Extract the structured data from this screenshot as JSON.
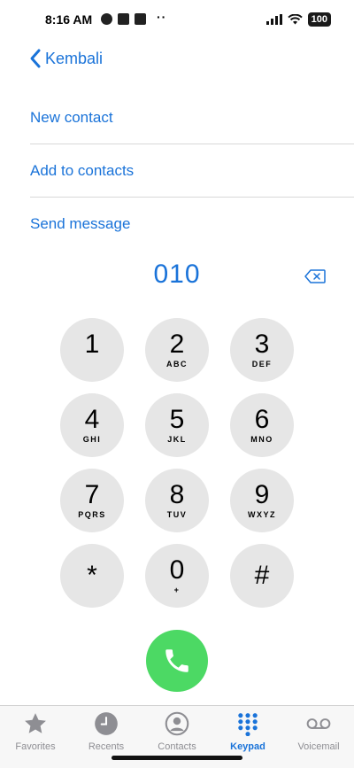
{
  "status_bar": {
    "time": "8:16 AM",
    "battery": "100",
    "dots": "··"
  },
  "nav": {
    "back_label": "Kembali"
  },
  "actions": [
    {
      "label": "New contact"
    },
    {
      "label": "Add to contacts"
    },
    {
      "label": "Send message"
    }
  ],
  "dialer": {
    "number": "010"
  },
  "keypad": [
    {
      "digit": "1",
      "letters": ""
    },
    {
      "digit": "2",
      "letters": "ABC"
    },
    {
      "digit": "3",
      "letters": "DEF"
    },
    {
      "digit": "4",
      "letters": "GHI"
    },
    {
      "digit": "5",
      "letters": "JKL"
    },
    {
      "digit": "6",
      "letters": "MNO"
    },
    {
      "digit": "7",
      "letters": "PQRS"
    },
    {
      "digit": "8",
      "letters": "TUV"
    },
    {
      "digit": "9",
      "letters": "WXYZ"
    },
    {
      "digit": "*",
      "letters": ""
    },
    {
      "digit": "0",
      "letters": "+"
    },
    {
      "digit": "#",
      "letters": ""
    }
  ],
  "tabs": [
    {
      "label": "Favorites",
      "icon": "star-icon",
      "active": false
    },
    {
      "label": "Recents",
      "icon": "clock-icon",
      "active": false
    },
    {
      "label": "Contacts",
      "icon": "person-circle-icon",
      "active": false
    },
    {
      "label": "Keypad",
      "icon": "keypad-grid-icon",
      "active": true
    },
    {
      "label": "Voicemail",
      "icon": "voicemail-icon",
      "active": false
    }
  ],
  "colors": {
    "accent": "#1a73d9",
    "call_green": "#4cd964",
    "key_bg": "#e6e6e6"
  }
}
